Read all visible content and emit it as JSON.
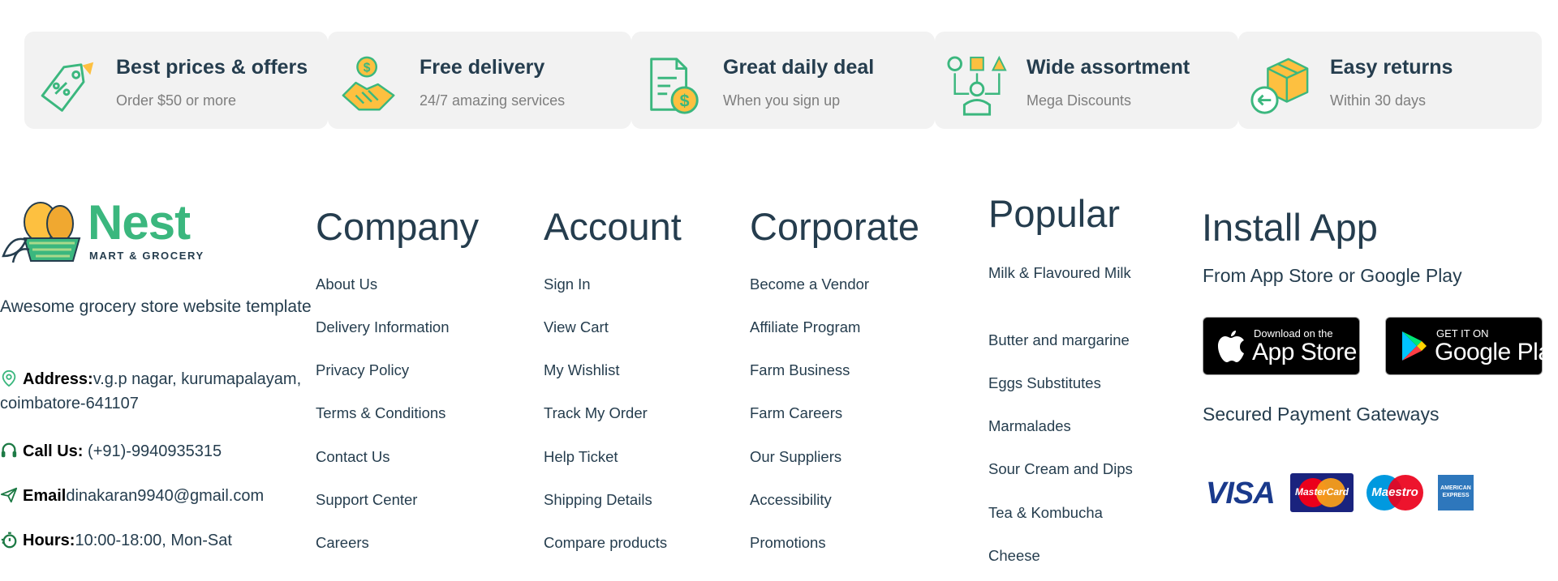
{
  "features": [
    {
      "title": "Best prices & offers",
      "subtitle": "Order $50 or more",
      "icon": "price-tag-icon"
    },
    {
      "title": "Free delivery",
      "subtitle": "24/7 amazing services",
      "icon": "handshake-icon"
    },
    {
      "title": "Great daily deal",
      "subtitle": "When you sign up",
      "icon": "document-dollar-icon"
    },
    {
      "title": "Wide assortment",
      "subtitle": "Mega Discounts",
      "icon": "assortment-person-icon"
    },
    {
      "title": "Easy returns",
      "subtitle": "Within 30 days",
      "icon": "return-box-icon"
    }
  ],
  "brand": {
    "name": "Nest",
    "tagline": "MART & GROCERY",
    "description": "Awesome grocery store website template"
  },
  "contact": {
    "address_label": "Address:",
    "address_value": "v.g.p nagar, kurumapalayam, coimbatore-641107",
    "call_label": "Call Us:",
    "call_value": "(+91)-9940935315",
    "email_label": "Email",
    "email_value": "dinakaran9940@gmail.com",
    "hours_label": "Hours:",
    "hours_value": "10:00-18:00, Mon-Sat"
  },
  "company": {
    "title": "Company",
    "links": [
      "About Us",
      "Delivery Information",
      "Privacy Policy",
      "Terms & Conditions",
      "Contact Us",
      "Support Center",
      "Careers"
    ]
  },
  "account": {
    "title": "Account",
    "links": [
      "Sign In",
      "View Cart",
      "My Wishlist",
      "Track My Order",
      "Help Ticket",
      "Shipping Details",
      "Compare products"
    ]
  },
  "corporate": {
    "title": "Corporate",
    "links": [
      "Become a Vendor",
      "Affiliate Program",
      "Farm Business",
      "Farm Careers",
      "Our Suppliers",
      "Accessibility",
      "Promotions"
    ]
  },
  "popular": {
    "title": "Popular",
    "links": [
      "Milk & Flavoured Milk",
      "Butter and margarine",
      "Eggs Substitutes",
      "Marmalades",
      "Sour Cream and Dips",
      "Tea & Kombucha",
      "Cheese"
    ]
  },
  "install": {
    "title": "Install App",
    "subtitle": "From App Store or Google Play",
    "appstore_small": "Download on the",
    "appstore_big": "App Store",
    "googleplay_small": "GET IT ON",
    "googleplay_big": "Google Play",
    "payment_title": "Secured Payment Gateways"
  },
  "payments": {
    "visa": "VISA",
    "mastercard": "MasterCard",
    "maestro": "Maestro",
    "amex": "AMERICAN EXPRESS"
  },
  "colors": {
    "brand_green": "#3bb77e",
    "icon_yellow": "#fdc040",
    "heading": "#253d4e",
    "muted": "#7e7e7e",
    "feature_bg": "#f2f2f2"
  }
}
